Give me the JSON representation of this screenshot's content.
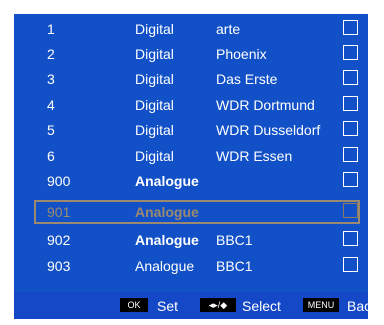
{
  "channels": [
    {
      "number": "1",
      "type": "Digital",
      "name": "arte"
    },
    {
      "number": "2",
      "type": "Digital",
      "name": "Phoenix"
    },
    {
      "number": "3",
      "type": "Digital",
      "name": "Das Erste"
    },
    {
      "number": "4",
      "type": "Digital",
      "name": "WDR Dortmund"
    },
    {
      "number": "5",
      "type": "Digital",
      "name": "WDR Dusseldorf"
    },
    {
      "number": "6",
      "type": "Digital",
      "name": "WDR Essen"
    },
    {
      "number": "900",
      "type": "Analogue",
      "name": ""
    },
    {
      "number": "901",
      "type": "Analogue",
      "name": ""
    },
    {
      "number": "902",
      "type": "Analogue",
      "name": "BBC1"
    },
    {
      "number": "903",
      "type": "Analogue",
      "name": "BBC1"
    }
  ],
  "footer": {
    "ok_key": "OK",
    "set_label": "Set",
    "nav_key": "◂▸/◆",
    "select_label": "Select",
    "menu_key": "MENU",
    "back_label": "Back"
  },
  "colors": {
    "panel": "#1150c6",
    "selection": "#9b8a70"
  }
}
